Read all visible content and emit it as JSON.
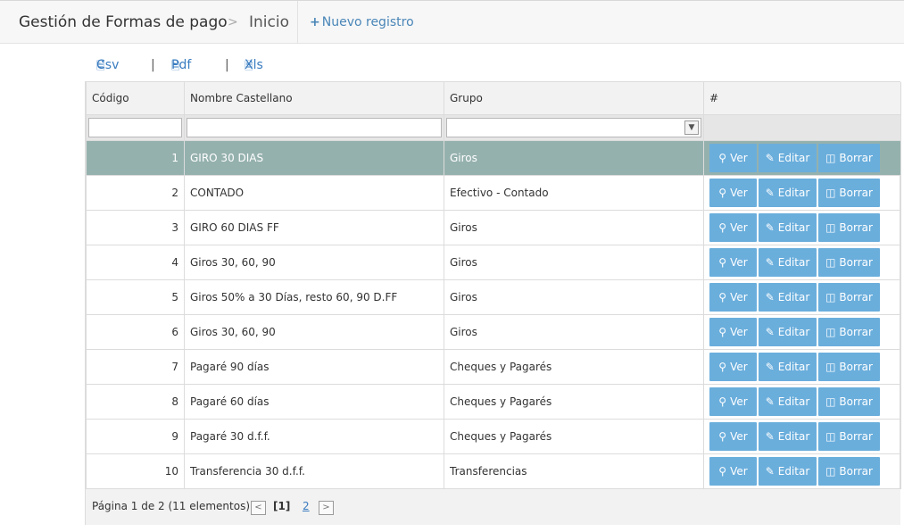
{
  "header": {
    "title": "Gestión de Formas de pago",
    "separator": ">",
    "crumb": "Inicio",
    "new_icon": "+",
    "new_label": "Nuevo registro"
  },
  "exports": {
    "csv": "Csv",
    "pdf": "Pdf",
    "xls": "Xls",
    "divider": "|"
  },
  "table": {
    "columns": [
      "Código",
      "Nombre Castellano",
      "Grupo",
      "#"
    ],
    "rows": [
      {
        "code": "1",
        "name": "GIRO 30 DIAS",
        "group": "Giros"
      },
      {
        "code": "2",
        "name": "CONTADO",
        "group": "Efectivo - Contado"
      },
      {
        "code": "3",
        "name": "GIRO 60 DIAS FF",
        "group": "Giros"
      },
      {
        "code": "4",
        "name": "Giros 30, 60, 90",
        "group": "Giros"
      },
      {
        "code": "5",
        "name": "Giros 50% a 30 Días, resto 60, 90 D.FF",
        "group": "Giros"
      },
      {
        "code": "6",
        "name": "Giros 30, 60, 90",
        "group": "Giros"
      },
      {
        "code": "7",
        "name": "Pagaré 90 días",
        "group": "Cheques y Pagarés"
      },
      {
        "code": "8",
        "name": "Pagaré 60 días",
        "group": "Cheques y Pagarés"
      },
      {
        "code": "9",
        "name": "Pagaré 30 d.f.f.",
        "group": "Cheques y Pagarés"
      },
      {
        "code": "10",
        "name": "Transferencia 30 d.f.f.",
        "group": "Transferencias"
      }
    ],
    "selected_row": 0,
    "actions": {
      "view": "Ver",
      "edit": "Editar",
      "delete": "Borrar"
    }
  },
  "pagination": {
    "info": "Página 1 de 2 (11 elementos)",
    "current": "[1]",
    "next_page": "2",
    "prev_symbol": "<",
    "next_symbol": ">"
  },
  "colors": {
    "accent": "#6aaedc",
    "selected_row": "#95b1ae",
    "link": "#3a7cc0"
  }
}
